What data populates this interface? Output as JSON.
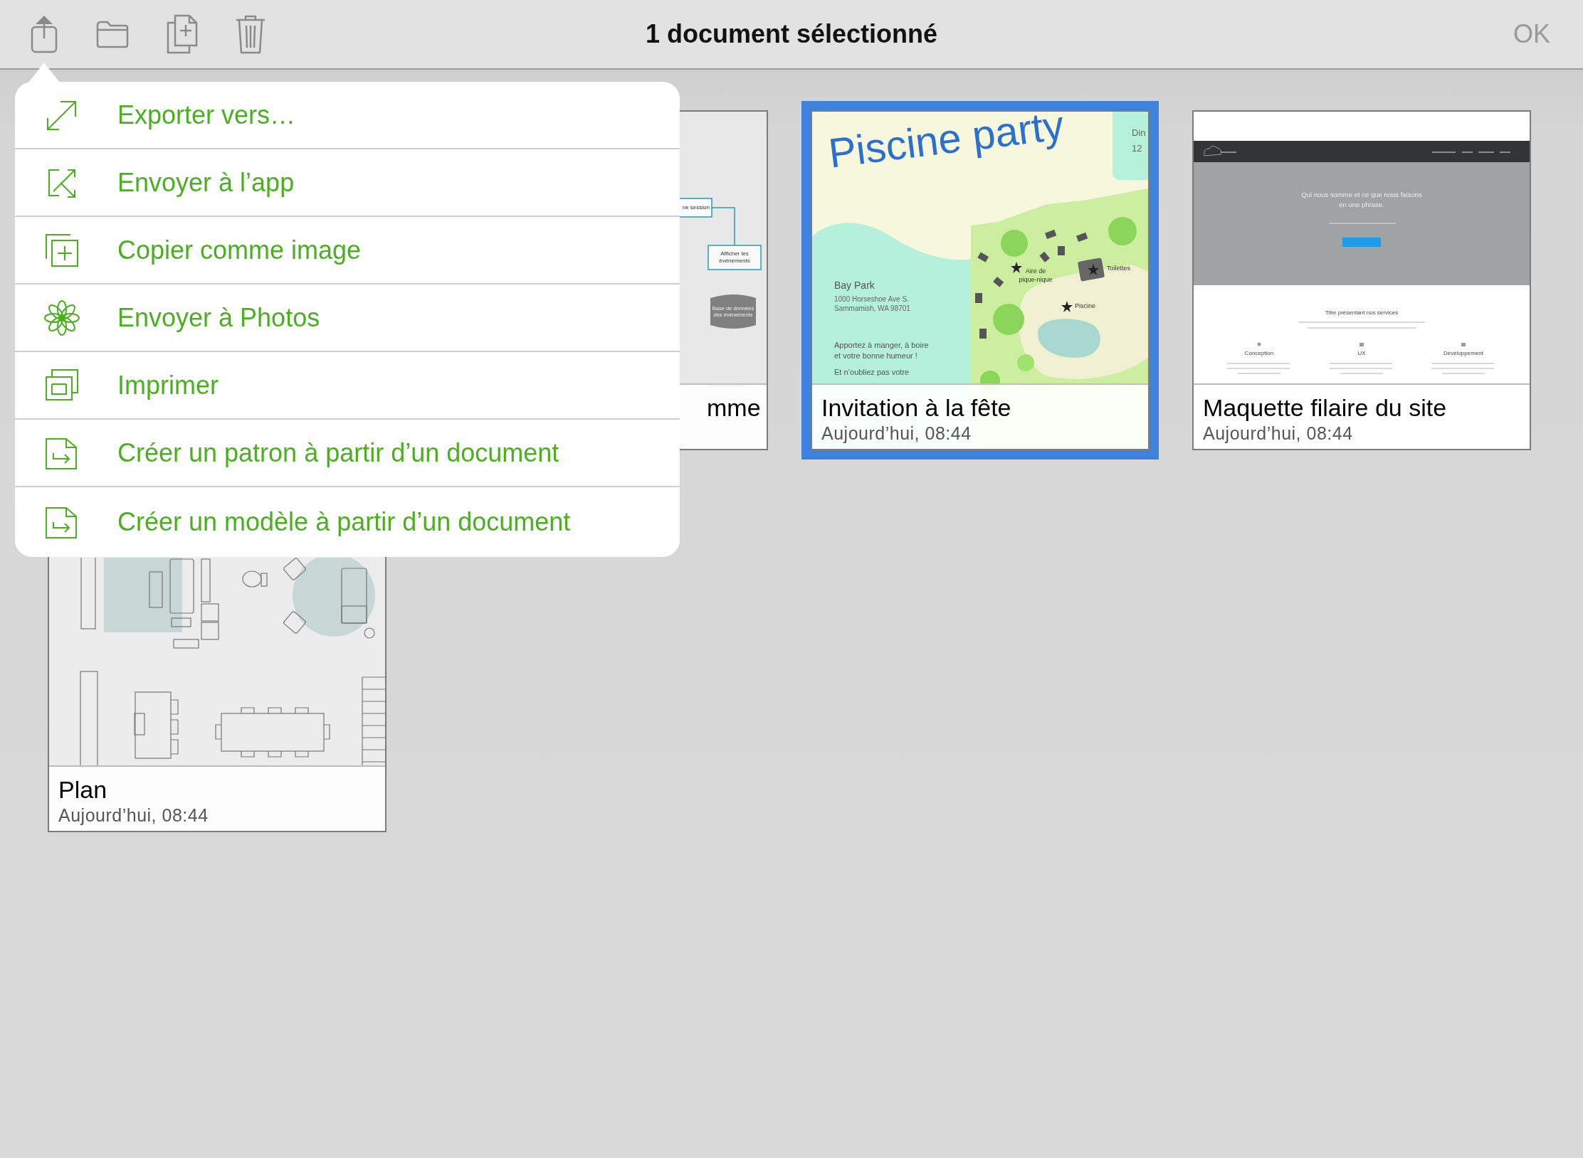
{
  "toolbar": {
    "title": "1 document sélectionné",
    "done_button": "OK"
  },
  "share_menu": {
    "items": [
      {
        "kind": "export",
        "label": "Exporter vers…"
      },
      {
        "kind": "send-app",
        "label": "Envoyer à l’app"
      },
      {
        "kind": "copy-image",
        "label": "Copier comme image"
      },
      {
        "kind": "photos",
        "label": "Envoyer à Photos"
      },
      {
        "kind": "print",
        "label": "Imprimer"
      },
      {
        "kind": "template",
        "label": "Créer un patron à partir d’un document"
      },
      {
        "kind": "template",
        "label": "Créer un modèle à partir d’un document"
      }
    ]
  },
  "documents": [
    {
      "kind": "flowchart",
      "selected": false,
      "title": "mme",
      "thumbnail": {
        "nodes": [
          "ne session",
          "Afficher les événements",
          "Base de données des événements"
        ]
      }
    },
    {
      "kind": "invitation",
      "selected": true,
      "title": "Invitation à la fête",
      "date": "Aujourd’hui, 08:44",
      "thumbnail": {
        "headline": "Piscine party",
        "date_tab": [
          "Din",
          "12"
        ],
        "venue": "Bay Park",
        "address": [
          "1000 Horseshoe Ave S.",
          "Sammamish, WA 98701"
        ],
        "notes": [
          "Apportez à manger, à boire",
          "et votre bonne humeur !",
          "Et n’oubliez pas votre"
        ],
        "map_labels": [
          "Aire de\npique-nique",
          "Toilettes",
          "Piscine"
        ]
      }
    },
    {
      "kind": "wireframe",
      "selected": false,
      "title": "Maquette filaire du site",
      "date": "Aujourd’hui, 08:44",
      "thumbnail": {
        "hero": "Qui nous somme et ce que nous faisons en une phrase.",
        "section_title": "Titre présentant nos services",
        "services": [
          "Conception",
          "UX",
          "Développement"
        ]
      }
    },
    {
      "kind": "plan",
      "selected": false,
      "title": "Plan",
      "date": "Aujourd’hui, 08:44"
    }
  ]
}
